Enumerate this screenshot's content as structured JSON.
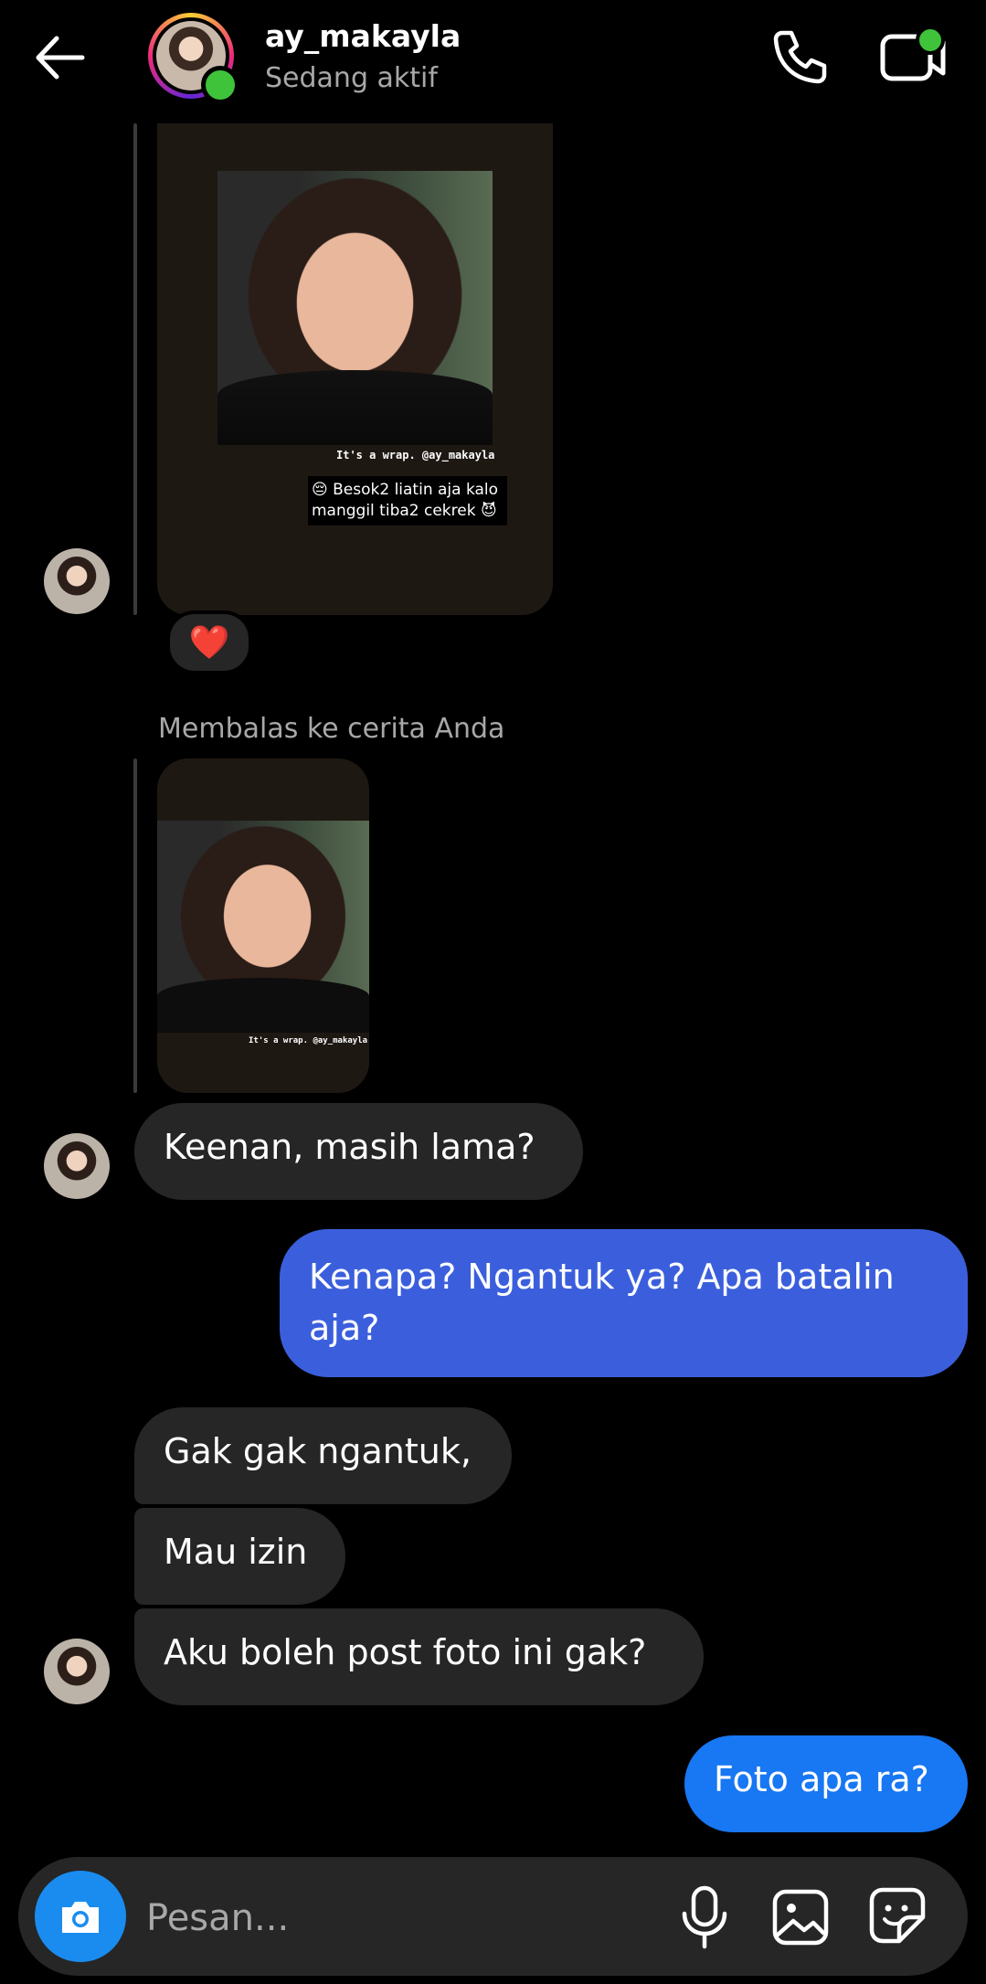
{
  "header": {
    "username": "ay_makayla",
    "status": "Sedang aktif",
    "active_color": "#3ec33a"
  },
  "stories": {
    "story1": {
      "credit": "It's a wrap. @ay_makayla",
      "caption": "😔 Besok2 liatin aja kalo manggil tiba2 cekrek 😈",
      "reaction": "❤️"
    },
    "reply_label": "Membalas ke cerita Anda",
    "story2": {
      "credit": "It's a wrap. @ay_makayla"
    }
  },
  "messages": [
    {
      "side": "in",
      "text": "Keenan, masih lama?"
    },
    {
      "side": "out",
      "text": "Kenapa? Ngantuk ya? Apa batalin aja?"
    },
    {
      "side": "in",
      "text": "Gak gak ngantuk,"
    },
    {
      "side": "in",
      "text": "Mau izin"
    },
    {
      "side": "in",
      "text": "Aku boleh post foto ini gak?"
    },
    {
      "side": "out",
      "text": "Foto apa ra?"
    }
  ],
  "composer": {
    "placeholder": "Pesan..."
  },
  "icons": {
    "back": "arrow-left-icon",
    "call": "phone-icon",
    "video": "video-camera-icon",
    "camera": "camera-icon",
    "mic": "microphone-icon",
    "gallery": "image-icon",
    "sticker": "sticker-icon"
  },
  "colors": {
    "incoming_bubble": "#262626",
    "outgoing_bubble_1": "#3b5fdc",
    "outgoing_bubble_2": "#1877f2",
    "camera_button": "#1a8cf0"
  }
}
